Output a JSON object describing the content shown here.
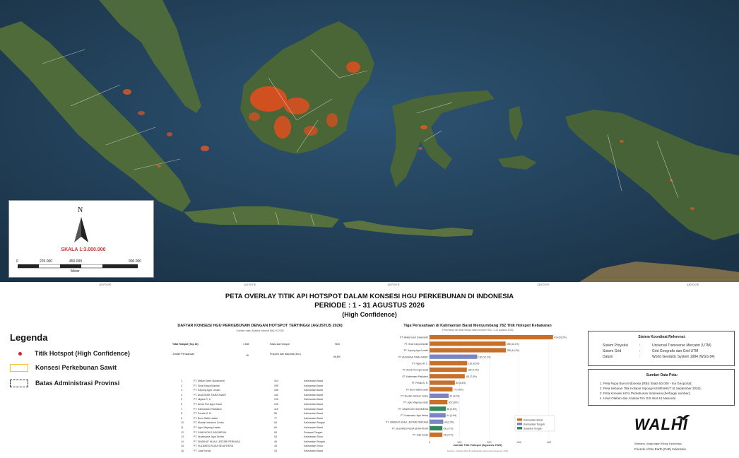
{
  "map": {
    "scale_label": "SKALA 1:3.000.000",
    "north_label": "N",
    "scale_ticks": [
      "0",
      "225.000",
      "450.000",
      "900.000"
    ],
    "scale_unit": "Meter",
    "coords": [
      "100°0'0\"E",
      "110°0'0\"E",
      "120°0'0\"E",
      "130°0'0\"E",
      "140°0'0\"E"
    ],
    "colors": {
      "sea": "#23425c",
      "land": "#4a6238",
      "hotspot": "#ff4a1a",
      "boundary": "#e8e8e8"
    }
  },
  "title": {
    "line1": "PETA OVERLAY TITIK API HOTSPOT DALAM KONSESI HGU PERKEBUNAN DI INDONESIA",
    "line2": "PERIODE : 1 - 31 AGUSTUS 2026",
    "line3": "(High Confidence)"
  },
  "legend": {
    "title": "Legenda",
    "items": [
      {
        "label": "Titik Hotspot (High Confidence)",
        "icon": "red-dot-icon",
        "color": "#e02020"
      },
      {
        "label": "Konsesi Perkebunan Sawit",
        "icon": "yellow-box-icon",
        "color": "#f2c232"
      },
      {
        "label": "Batas Administrasi Provinsi",
        "icon": "dashed-box-icon",
        "color": "#222222"
      }
    ]
  },
  "table": {
    "title": "DAFTAR KONSESI HGU PERKEBUNAN DENGAN HOTSPOT TERTINGGI (AGUSTUS 2026)",
    "subtitle": "Sumber data: Analisis Internal WALHI 2026",
    "summary": [
      {
        "label": "Total Hotspot (Top 16)",
        "value": "1.581"
      },
      {
        "label": "Jumlah Perusahaan",
        "value": "16"
      },
      {
        "label": "Rata-rata Hotspot",
        "value": "98,8"
      },
      {
        "label": "Proporsi dari Nasional (Est.)",
        "value": "66,8%"
      }
    ],
    "rows": [
      {
        "no": "1",
        "name": "PT. Mekar Karet Sukamantri",
        "hotspot": "414",
        "province": "Kalimantan Barat"
      },
      {
        "no": "2",
        "name": "PT. Sinar Karya Mandiri",
        "hotspot": "255",
        "province": "Kalimantan Barat"
      },
      {
        "no": "3",
        "name": "PT. Kayung Agro Lestari",
        "hotspot": "256",
        "province": "Kalimantan Barat"
      },
      {
        "no": "4",
        "name": "PT. ANUGRAH TIARA SAWIT",
        "hotspot": "160",
        "province": "Kalimantan Barat"
      },
      {
        "no": "5",
        "name": "PT. Nigara R. C.",
        "hotspot": "126",
        "province": "Kalimantan Barat"
      },
      {
        "no": "6",
        "name": "PT. Aerial Puri Agro Sawit",
        "hotspot": "125",
        "province": "Kalimantan Barat"
      },
      {
        "no": "7",
        "name": "PT. Kalimantan Plantation",
        "hotspot": "118",
        "province": "Kalimantan Barat"
      },
      {
        "no": "8",
        "name": "PT. Persila S. R.",
        "hotspot": "85",
        "province": "Kalimantan Barat"
      },
      {
        "no": "9",
        "name": "PT. Bumi Sakti Lestari",
        "hotspot": "77",
        "province": "Kalimantan Barat"
      },
      {
        "no": "10",
        "name": "PT. Mustari Indotech Graha",
        "hotspot": "64",
        "province": "Kalimantan Tengah"
      },
      {
        "no": "11",
        "name": "PT. Agro Mayang Lestari",
        "hotspot": "60",
        "province": "Kalimantan Barat"
      },
      {
        "no": "12",
        "name": "PT. SANGKOKO INDONESIA",
        "hotspot": "55",
        "province": "Sulawesi Tengah"
      },
      {
        "no": "13",
        "name": "PT. Hutamanta Jaya Sentra",
        "hotspot": "54",
        "province": "Kalimantan Timur"
      },
      {
        "no": "14",
        "name": "PT. SINDIKAT HIJAU LESTARI PERKASA",
        "hotspot": "46",
        "province": "Kalimantan Tengah"
      },
      {
        "no": "15",
        "name": "PT. SULAWESI NUSA SEJAHTERA",
        "hotspot": "43",
        "province": "Kalimantan Timur"
      },
      {
        "no": "16",
        "name": "PT. Julia Kurnia",
        "hotspot": "43",
        "province": "Kalimantan Barat"
      }
    ]
  },
  "chart_data": {
    "type": "bar",
    "orientation": "horizontal",
    "title": "Tiga Perusahaan di Kalimantan Barat Menyumbang 782 Titik Hotspot Kebakaran",
    "subtitle": "(Persentase dari total hotspot dalam konsesi HGU, 1–31 Agustus 2026)",
    "xlabel": "Jumlah Titik Hotspot (Agustus 2026)",
    "note": "Sumber: Analisis WALHI berdasarkan data hotspot Agustus 2026",
    "categories": [
      "PT. Mekar Karet Sukamantri",
      "PT. Sinar Karya Mandiri",
      "PT. Kayung Agro Lestari",
      "PT. ANUGRAH TIARA SAWIT",
      "PT. Nigara R. C.",
      "PT. Aerial Puri Agro Sawit",
      "PT. Kalimantan Plantation",
      "PT. Persila S. R.",
      "PT. Bumi Sakti Lestari",
      "PT. Mustari Indotech Graha",
      "PT. Agro Mayang Lestari",
      "PT. SANGKOKO INDONESIA",
      "PT. Hutamanta Jaya Sentra",
      "PT. SINDIKAT HIJAU LESTARI PERKASA",
      "PT. SULAWESI NUSA SEJAHTERA",
      "PT. Julia Kurnia"
    ],
    "values": [
      414,
      255,
      256,
      160,
      126,
      125,
      118,
      85,
      77,
      64,
      60,
      55,
      54,
      46,
      43,
      43
    ],
    "value_labels": [
      "414 (26,2%)",
      "255 (16,1%)",
      "256 (16,2%)",
      "160 (10,1%)",
      "126 (8,0%)",
      "125 (7,9%)",
      "118 (7,5%)",
      "85 (5,4%)",
      "77 (4,9%)",
      "64 (4,0%)",
      "60 (3,8%)",
      "55 (3,5%)",
      "54 (3,4%)",
      "46 (2,9%)",
      "43 (2,7%)",
      "43 (2,7%)"
    ],
    "bar_colors": [
      "#c8702a",
      "#c8702a",
      "#c8702a",
      "#7a86c4",
      "#c8702a",
      "#c8702a",
      "#c8702a",
      "#c8702a",
      "#c8702a",
      "#7a86c4",
      "#c8702a",
      "#2e8a5a",
      "#7a86c4",
      "#7a86c4",
      "#2e8a5a",
      "#c8702a"
    ],
    "xlim": [
      0,
      450
    ],
    "xticks": [
      "0",
      "100",
      "200",
      "300",
      "400"
    ],
    "legend": [
      {
        "name": "Kalimantan Barat",
        "color": "#c8702a"
      },
      {
        "name": "Kalimantan Tengah",
        "color": "#7a86c4"
      },
      {
        "name": "Sulawesi Tengah",
        "color": "#2e8a5a"
      }
    ],
    "legend_position": "bottom-right"
  },
  "reference": {
    "title": "Sistem Koordinat Referensi:",
    "rows": [
      {
        "key": "Sistem Proyeksi",
        "sep": ":",
        "value": "Universal Transverse Mercator (UTM)"
      },
      {
        "key": "Sistem Grid",
        "sep": ":",
        "value": "Grid Geografis dan Grid UTM"
      },
      {
        "key": "Datum",
        "sep": ":",
        "value": "World Geodetic System 1984 (WGS 84)"
      }
    ]
  },
  "sources": {
    "title": "Sumber Data Peta:",
    "items": [
      "1. Peta Rupa Bumi Indonesia (RBI) Skala 50.000 - Ina Geoportal;",
      "2. Peta Sebaran Titik Hotspot Sipongi KEMENHUT (6 September 2026);",
      "3. Peta Konsesi HGU Perkebunan Indonesia (berbagai sumber);",
      "4. Hasil Olahan dan Analisa Tim GIS WALHI Nasional."
    ]
  },
  "logo": {
    "word": "WALHI",
    "line1": "Wahana Lingkungan Hidup Indonesia",
    "line2": "Friends of the Earth (FoE) Indonesia"
  }
}
